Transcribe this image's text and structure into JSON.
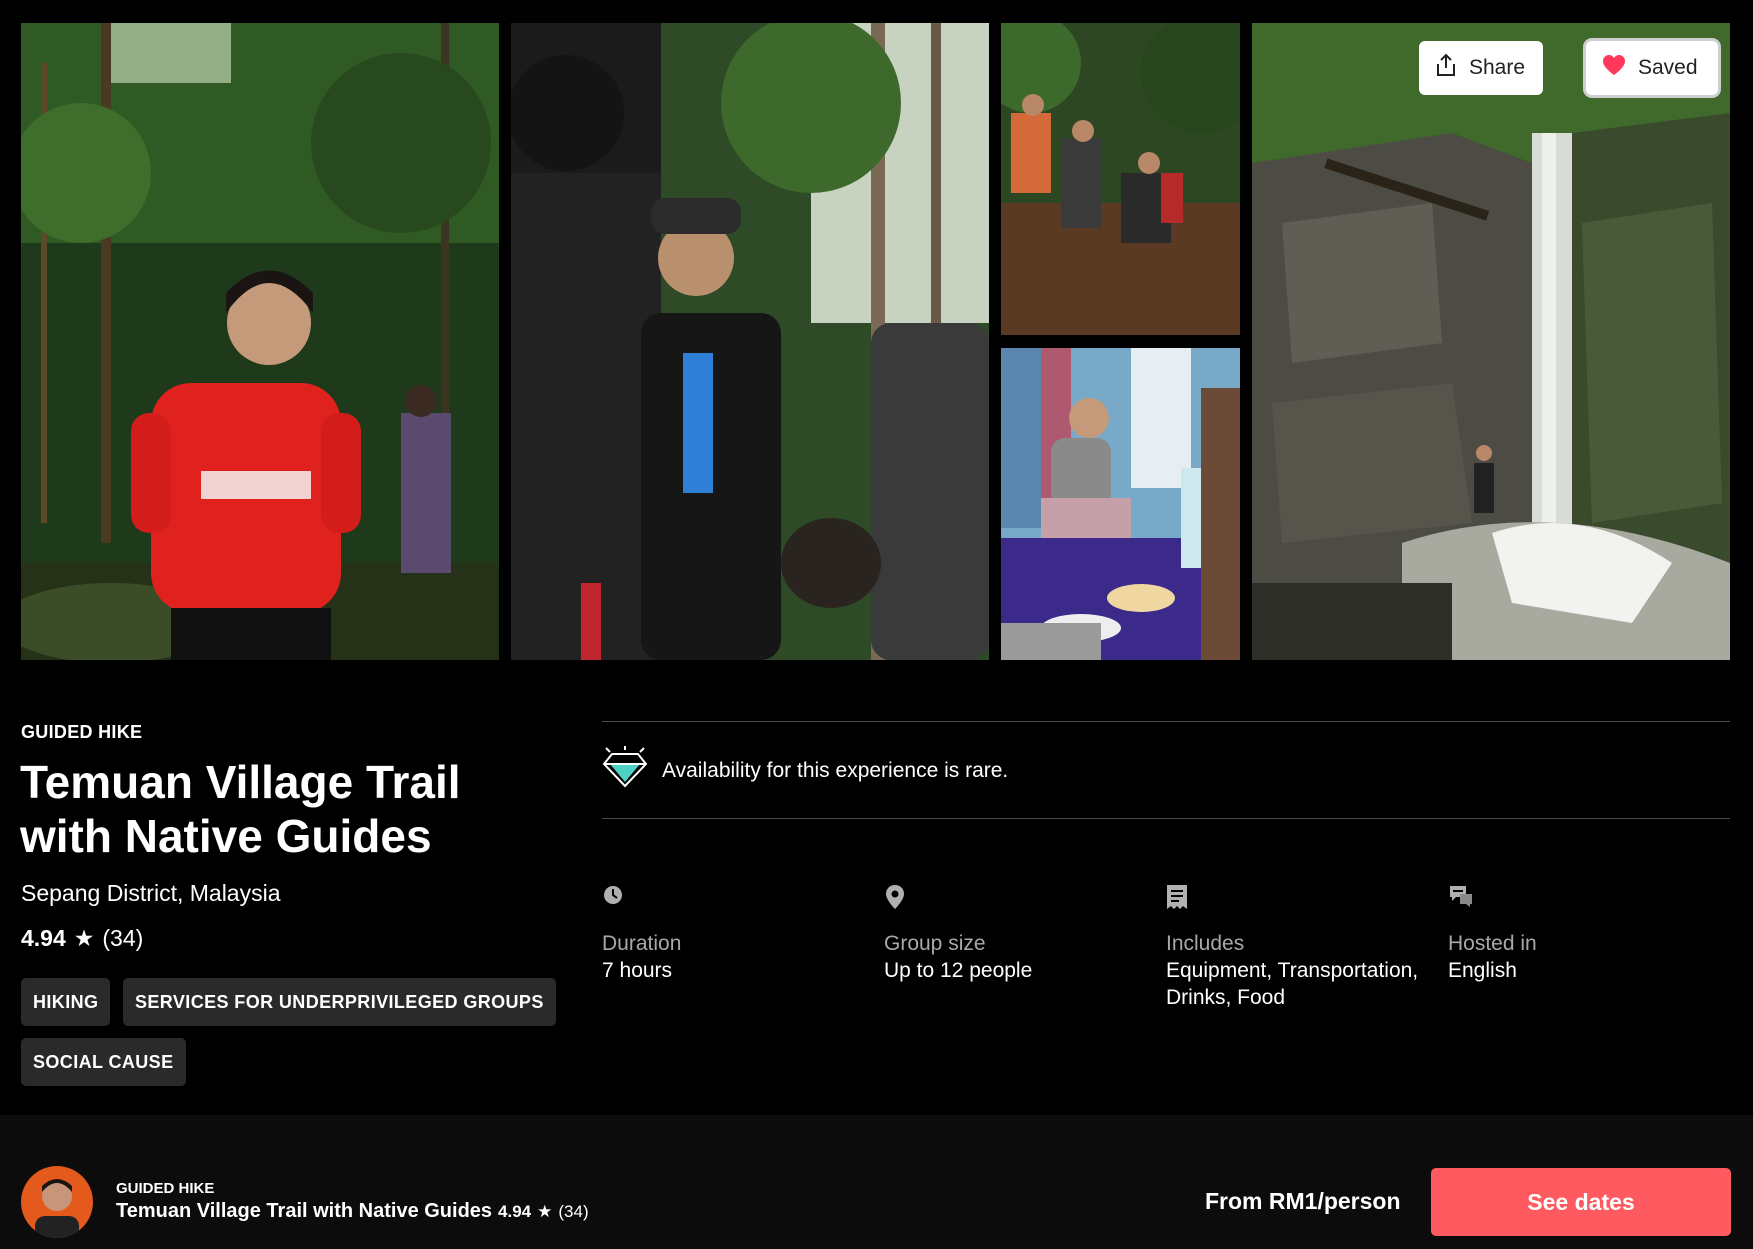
{
  "gallery": {
    "share_label": "Share",
    "saved_label": "Saved",
    "share_icon": "share-icon",
    "saved_icon": "heart-icon",
    "photos": [
      {
        "name": "photo-laughing-hiker"
      },
      {
        "name": "photo-guides-talking"
      },
      {
        "name": "photo-climbing-hikers"
      },
      {
        "name": "photo-village-meal"
      },
      {
        "name": "photo-waterfall"
      }
    ]
  },
  "experience": {
    "category": "GUIDED HIKE",
    "title": "Temuan Village Trail with Native Guides",
    "location": "Sepang District, Malaysia",
    "rating": "4.94",
    "star": "★",
    "review_count": "(34)",
    "tags": [
      "HIKING",
      "SERVICES FOR UNDERPRIVILEGED GROUPS",
      "SOCIAL CAUSE"
    ]
  },
  "rare_notice": {
    "icon": "diamond-icon",
    "text": "Availability for this experience is rare."
  },
  "facts": [
    {
      "icon": "clock-icon",
      "label": "Duration",
      "value": "7 hours"
    },
    {
      "icon": "location-pin-icon",
      "label": "Group size",
      "value": "Up to 12 people"
    },
    {
      "icon": "includes-list-icon",
      "label": "Includes",
      "value": "Equipment, Transportation, Drinks, Food"
    },
    {
      "icon": "chat-bubble-icon",
      "label": "Hosted in",
      "value": "English"
    }
  ],
  "booking_bar": {
    "category": "GUIDED HIKE",
    "title": "Temuan Village Trail with Native Guides",
    "rating": "4.94",
    "star": "★",
    "review_count": "(34)",
    "price": "From RM1/person",
    "cta_label": "See dates"
  },
  "colors": {
    "background": "#000000",
    "accent": "#ff5a5f",
    "tag_background": "#2a2a2a",
    "muted_text": "#a8a8a8",
    "heart": "#ff385c"
  }
}
